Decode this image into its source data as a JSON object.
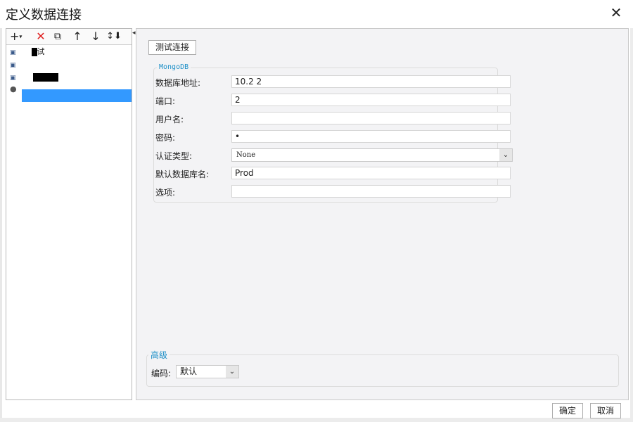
{
  "window": {
    "title": "定义数据连接",
    "close_icon": "close-icon"
  },
  "toolbar": {
    "add": "+",
    "add_caret": "▾",
    "delete": "✕",
    "copy": "⧉",
    "up": "↑",
    "down": "↓",
    "sort": "↕⬇"
  },
  "tree": {
    "items": [
      {
        "icon": "▣",
        "label": "试"
      },
      {
        "icon": "▣",
        "label": ""
      },
      {
        "icon": "▣",
        "label": ""
      },
      {
        "icon": "●",
        "label": ""
      }
    ]
  },
  "test_button": "测试连接",
  "mongo": {
    "legend": "MongoDB",
    "fields": {
      "host_label": "数据库地址:",
      "host_value": "10.2        2",
      "port_label": "端口:",
      "port_value": "2",
      "user_label": "用户名:",
      "user_value": "",
      "password_label": "密码:",
      "password_value": "•",
      "auth_label": "认证类型:",
      "auth_value": "None",
      "db_label": "默认数据库名:",
      "db_value": "Prod",
      "options_label": "选项:",
      "options_value": ""
    }
  },
  "advanced": {
    "legend": "高级",
    "encoding_label": "编码:",
    "encoding_value": "默认"
  },
  "footer": {
    "ok": "确定",
    "cancel": "取消"
  },
  "colors": {
    "selection": "#3399ff",
    "delete_red": "#e02020",
    "legend_blue": "#1e90c8"
  }
}
